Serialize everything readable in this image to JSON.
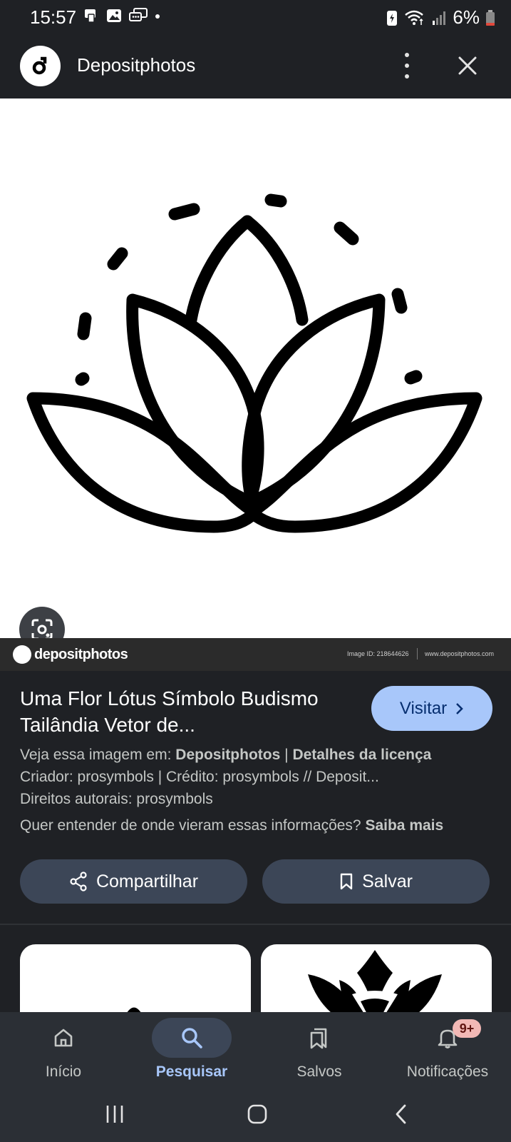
{
  "status": {
    "time": "15:57",
    "battery": "6%"
  },
  "header": {
    "site_name": "Depositphotos",
    "logo_letter": "d",
    "more_icon": "more-vert-icon",
    "close_icon": "close-icon"
  },
  "image": {
    "footer_logo": "depositphotos",
    "image_id": "Image ID: 218644626",
    "site_url": "www.depositphotos.com",
    "watermark": "depositphotos"
  },
  "info": {
    "title": "Uma Flor Lótus Símbolo Budismo Tailândia Vetor de...",
    "visit_label": "Visitar",
    "view_prefix": "Veja essa imagem em:",
    "view_source": "Depositphotos",
    "license_sep": "|",
    "license_link": "Detalhes da licença",
    "creator_line": "Criador: prosymbols | Crédito: prosymbols // Deposit...",
    "copyright_line": "Direitos autorais: prosymbols",
    "learn_prefix": "Quer entender de onde vieram essas informações?",
    "learn_link": "Saiba mais",
    "share_label": "Compartilhar",
    "save_label": "Salvar"
  },
  "bottom_nav": {
    "items": [
      {
        "label": "Início",
        "icon": "home-icon"
      },
      {
        "label": "Pesquisar",
        "icon": "search-icon",
        "active": true
      },
      {
        "label": "Salvos",
        "icon": "collections-icon"
      },
      {
        "label": "Notificações",
        "icon": "bell-icon",
        "badge": "9+"
      }
    ]
  },
  "colors": {
    "background": "#1f2125",
    "accent": "#a8c7fa",
    "button": "#3c4657",
    "nav": "#2b2f35"
  }
}
